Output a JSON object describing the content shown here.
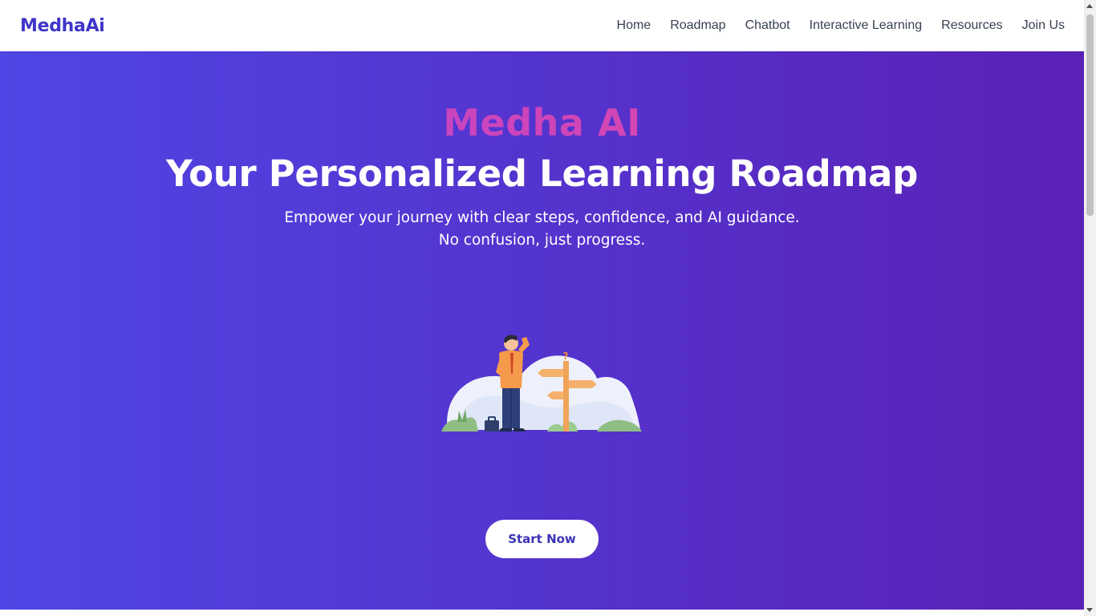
{
  "navbar": {
    "brand": "MedhaAi",
    "links": [
      "Home",
      "Roadmap",
      "Chatbot",
      "Interactive Learning",
      "Resources",
      "Join Us"
    ]
  },
  "hero": {
    "brand": "Medha AI",
    "title": "Your Personalized Learning Roadmap",
    "subtitle": "Empower your journey with clear steps, confidence, and AI guidance. No confusion, just progress.",
    "illustration_icon": "person-at-signpost-illustration",
    "cta_label": "Start Now"
  },
  "colors": {
    "brand": "#3f35c8",
    "hero_gradient_start": "#4f46e5",
    "hero_gradient_end": "#5a21b6",
    "accent_gradient_start": "#b042d9",
    "accent_gradient_end": "#ec4899",
    "nav_text": "#374151"
  }
}
